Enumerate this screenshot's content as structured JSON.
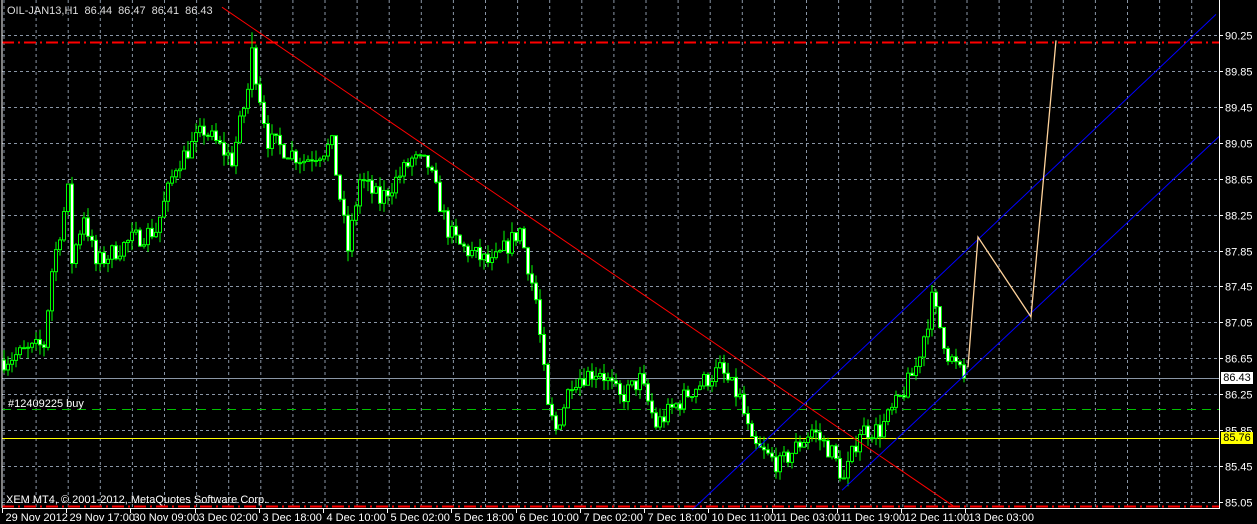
{
  "header": {
    "symbol": "OIL-JAN13,H1",
    "open": "86.44",
    "high": "86.47",
    "low": "86.41",
    "close": "86.43"
  },
  "copyright": "XEM MT4, © 2001-2012, MetaQuotes Software Corp.",
  "order_label": "#12409225 buy",
  "bid_tag": "86.43",
  "level_tag": "85.76",
  "colors": {
    "bg": "#000000",
    "candle": "#00ff00",
    "grid": "#8a96a6",
    "trend": "#ff0000",
    "channel": "#0000ff",
    "zigzag": "#ffd39b",
    "bid": "#8a96a6",
    "buy": "#00c000",
    "level": "#ffff00",
    "stop": "#ff0000"
  },
  "chart_data": {
    "type": "candlestick",
    "title": "OIL-JAN13,H1",
    "ylim": [
      85.0,
      90.3
    ],
    "y_ticks": [
      "90.25",
      "89.85",
      "89.45",
      "89.05",
      "88.65",
      "88.25",
      "87.85",
      "87.45",
      "87.05",
      "86.65",
      "86.25",
      "85.85",
      "85.45",
      "85.05"
    ],
    "x_ticks": [
      "29 Nov 2012",
      "29 Nov 17:00",
      "30 Nov 09:00",
      "3 Dec 02:00",
      "3 Dec 18:00",
      "4 Dec 10:00",
      "5 Dec 02:00",
      "5 Dec 18:00",
      "6 Dec 10:00",
      "7 Dec 02:00",
      "7 Dec 18:00",
      "10 Dec 11:00",
      "11 Dec 03:00",
      "11 Dec 19:00",
      "12 Dec 11:00",
      "13 Dec 03:00"
    ],
    "bars_per_x_tick": 16,
    "close_keypoints": [
      [
        0,
        86.63
      ],
      [
        10,
        86.8
      ],
      [
        12,
        87.63
      ],
      [
        16,
        88.5
      ],
      [
        17,
        87.74
      ],
      [
        20,
        88.25
      ],
      [
        23,
        87.7
      ],
      [
        32,
        87.97
      ],
      [
        38,
        88.08
      ],
      [
        43,
        88.8
      ],
      [
        50,
        89.19
      ],
      [
        57,
        88.86
      ],
      [
        61,
        89.64
      ],
      [
        62,
        90.05
      ],
      [
        66,
        89.08
      ],
      [
        75,
        88.86
      ],
      [
        82,
        89.02
      ],
      [
        86,
        87.86
      ],
      [
        89,
        88.64
      ],
      [
        94,
        88.41
      ],
      [
        102,
        88.86
      ],
      [
        106,
        88.8
      ],
      [
        111,
        88.08
      ],
      [
        114,
        87.9
      ],
      [
        122,
        87.69
      ],
      [
        129,
        88.08
      ],
      [
        133,
        87.3
      ],
      [
        136,
        86.07
      ],
      [
        138,
        85.85
      ],
      [
        142,
        86.41
      ],
      [
        149,
        86.52
      ],
      [
        154,
        86.2
      ],
      [
        159,
        86.41
      ],
      [
        163,
        85.91
      ],
      [
        172,
        86.3
      ],
      [
        179,
        86.52
      ],
      [
        184,
        86.2
      ],
      [
        187,
        85.68
      ],
      [
        194,
        85.46
      ],
      [
        202,
        85.85
      ],
      [
        207,
        85.6
      ],
      [
        210,
        85.29
      ],
      [
        214,
        85.85
      ],
      [
        219,
        85.85
      ],
      [
        224,
        86.2
      ],
      [
        228,
        86.55
      ],
      [
        231,
        87.08
      ],
      [
        232,
        87.3
      ],
      [
        236,
        86.7
      ],
      [
        240,
        86.43
      ]
    ],
    "horizontal_levels": [
      {
        "name": "take-profit",
        "price": 90.17,
        "style": "dash-dot",
        "color": "#ff0000"
      },
      {
        "name": "bid",
        "price": 86.43,
        "style": "solid",
        "color": "#8a96a6"
      },
      {
        "name": "buy-order",
        "price": 86.09,
        "style": "dashed",
        "color": "#00c000"
      },
      {
        "name": "support",
        "price": 85.76,
        "style": "solid",
        "color": "#ffff00"
      },
      {
        "name": "stop-loss",
        "price": 85.0,
        "style": "dash-dot",
        "color": "#ff0000"
      }
    ],
    "trendlines": [
      {
        "name": "downtrend",
        "color": "#ff0000",
        "points": [
          [
            54.5,
            90.56
          ],
          [
            237.5,
            85.0
          ]
        ]
      },
      {
        "name": "channel-upper",
        "color": "#0000ff",
        "points": [
          [
            172,
            84.96
          ],
          [
            303,
            90.48
          ]
        ]
      },
      {
        "name": "channel-lower",
        "color": "#0000ff",
        "points": [
          [
            209.5,
            85.18
          ],
          [
            304,
            89.13
          ]
        ]
      }
    ],
    "zigzag": {
      "color": "#ffd39b",
      "points": [
        [
          241,
          86.55
        ],
        [
          243.5,
          88.0
        ],
        [
          256.75,
          87.11
        ],
        [
          263,
          90.19
        ]
      ]
    }
  }
}
